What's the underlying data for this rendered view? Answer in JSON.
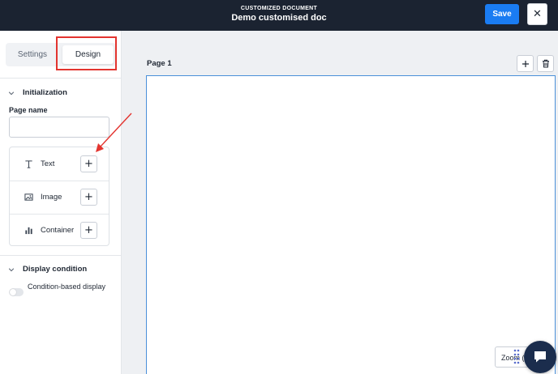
{
  "header": {
    "subtitle": "CUSTOMIZED DOCUMENT",
    "title": "Demo customised doc",
    "save_label": "Save",
    "close_glyph": "✕"
  },
  "sidebar": {
    "tabs": [
      {
        "label": "Settings",
        "active": false
      },
      {
        "label": "Design",
        "active": true
      }
    ],
    "initialization": {
      "heading": "Initialization",
      "page_name_label": "Page name",
      "page_name_value": "",
      "components": [
        {
          "label": "Text",
          "icon": "text-type-icon"
        },
        {
          "label": "Image",
          "icon": "image-icon"
        },
        {
          "label": "Container",
          "icon": "bar-chart-icon"
        }
      ]
    },
    "display_condition": {
      "heading": "Display condition",
      "toggle_label": "Condition-based display",
      "enabled": false
    }
  },
  "canvas": {
    "page_title": "Page 1",
    "zoom_label": "Zoom ("
  },
  "colors": {
    "topbar": "#1b2331",
    "accent": "#1a7cf2",
    "annotation": "#e3342f",
    "canvas_border": "#4a90d9"
  }
}
